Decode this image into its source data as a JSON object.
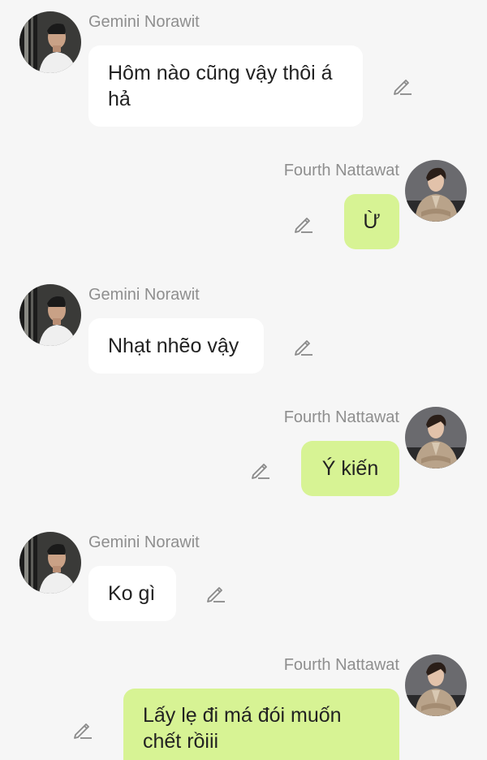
{
  "messages": [
    {
      "sender": "Gemini Norawit",
      "side": "left",
      "text": "Hôm nào cũng vậy thôi á hả",
      "edit_icon": "pencil-icon"
    },
    {
      "sender": "Fourth Nattawat",
      "side": "right",
      "text": "Ừ",
      "edit_icon": "pencil-icon"
    },
    {
      "sender": "Gemini Norawit",
      "side": "left",
      "text": "Nhạt nhẽo vậy",
      "edit_icon": "pencil-icon"
    },
    {
      "sender": "Fourth Nattawat",
      "side": "right",
      "text": "Ý kiến",
      "edit_icon": "pencil-icon"
    },
    {
      "sender": "Gemini Norawit",
      "side": "left",
      "text": "Ko gì",
      "edit_icon": "pencil-icon"
    },
    {
      "sender": "Fourth Nattawat",
      "side": "right",
      "text": "Lấy lẹ đi má đói muốn chết rồiii",
      "edit_icon": "pencil-icon"
    }
  ],
  "colors": {
    "background": "#f6f6f6",
    "left_bubble": "#ffffff",
    "right_bubble": "#d7f394",
    "sender_name": "#8e8e8e",
    "message_text": "#222222"
  }
}
